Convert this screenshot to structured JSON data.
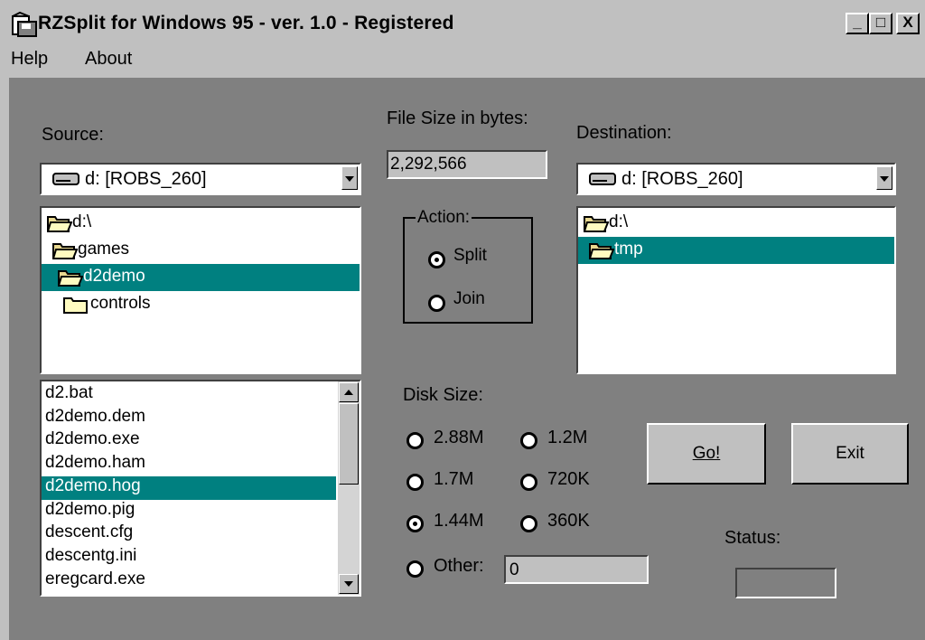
{
  "window": {
    "title": "RZSplit for Windows 95 - ver. 1.0 - Registered",
    "minimize": "_",
    "maximize": "□",
    "close": "X"
  },
  "menu": [
    "Help",
    "About"
  ],
  "source": {
    "label": "Source:",
    "drive": "d: [ROBS_260]",
    "folders": [
      {
        "name": "d:\\",
        "selected": false
      },
      {
        "name": "games",
        "selected": false
      },
      {
        "name": "d2demo",
        "selected": true
      },
      {
        "name": "controls",
        "selected": false
      }
    ],
    "files": [
      "d2.bat",
      "d2demo.dem",
      "d2demo.exe",
      "d2demo.ham",
      "d2demo.hog",
      "d2demo.pig",
      "descent.cfg",
      "descentg.ini",
      "eregcard.exe"
    ],
    "selected_file": "d2demo.hog"
  },
  "file_size": {
    "label": "File Size in bytes:",
    "value": "2,292,566"
  },
  "action": {
    "label": "Action:",
    "options": [
      "Split",
      "Join"
    ],
    "selected": "Split"
  },
  "destination": {
    "label": "Destination:",
    "drive": "d: [ROBS_260]",
    "folders": [
      {
        "name": "d:\\",
        "selected": false
      },
      {
        "name": "tmp",
        "selected": true
      }
    ]
  },
  "disk_size": {
    "label": "Disk Size:",
    "options": [
      "2.88M",
      "1.2M",
      "1.7M",
      "720K",
      "1.44M",
      "360K"
    ],
    "selected": "1.44M",
    "other_label": "Other:",
    "other_value": "0"
  },
  "buttons": {
    "go": "Go!",
    "exit": "Exit"
  },
  "status": {
    "label": "Status:",
    "value": ""
  },
  "colors": {
    "face": "#c0c0c0",
    "client": "#808080",
    "selection": "#008080"
  }
}
